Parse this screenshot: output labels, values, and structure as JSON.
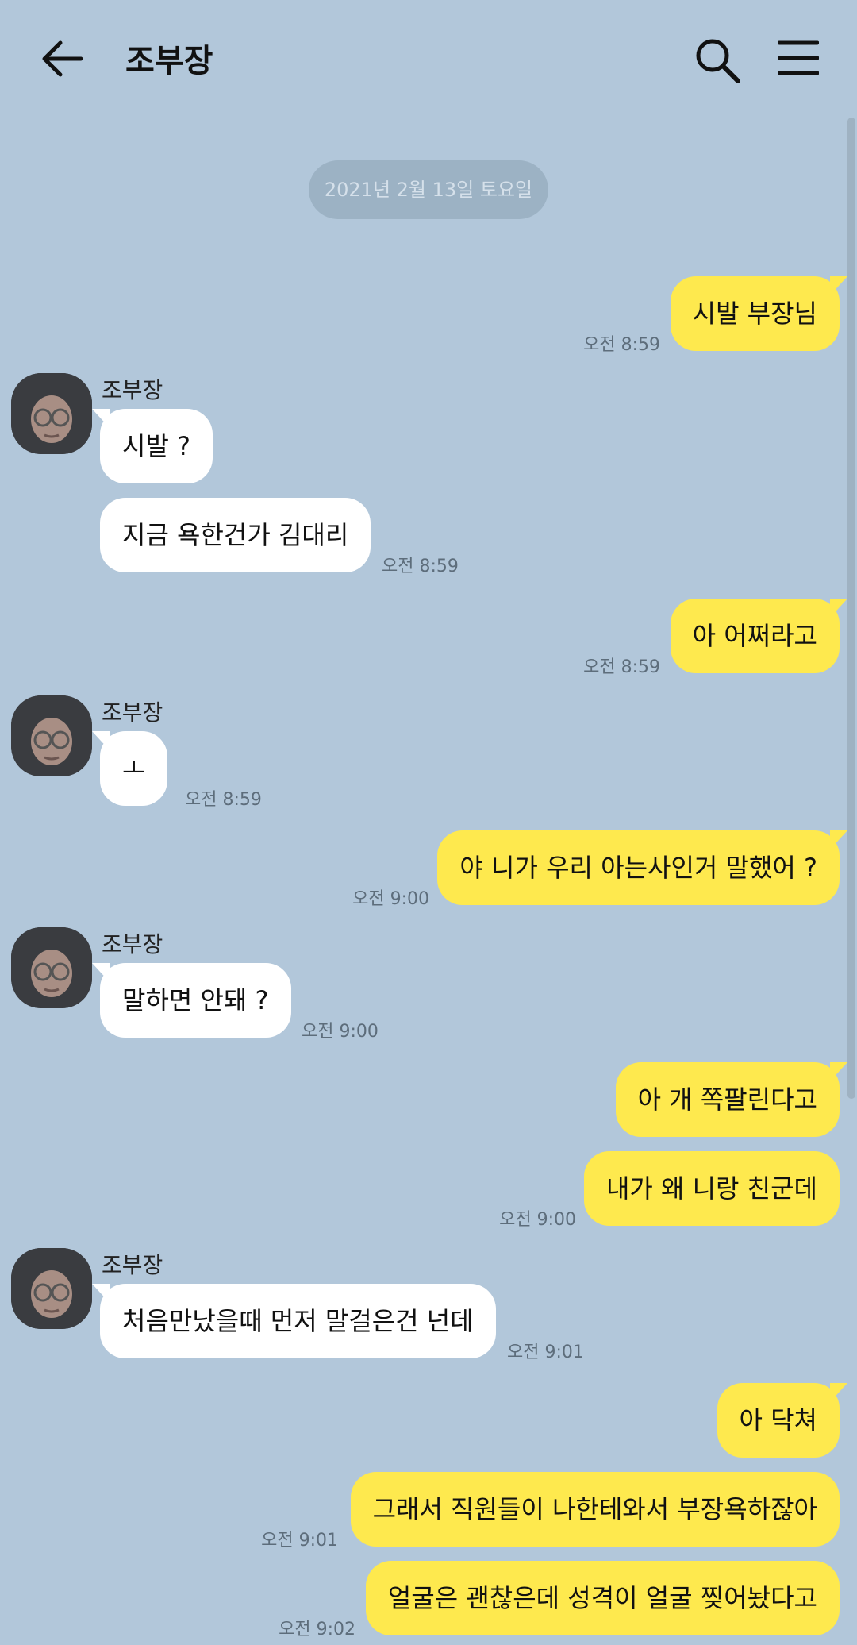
{
  "header": {
    "title": "조부장",
    "back_icon": "arrow-left-icon",
    "search_icon": "search-icon",
    "menu_icon": "hamburger-menu-icon"
  },
  "date_divider": "2021년 2월 13일 토요일",
  "sender_name": "조부장",
  "messages": [
    {
      "text": "시발 부장님",
      "time": "오전 8:59",
      "from": "me"
    },
    {
      "text": "시발 ?",
      "from": "other"
    },
    {
      "text": "지금 욕한건가 김대리",
      "time": "오전 8:59",
      "from": "other"
    },
    {
      "text": "아 어쩌라고",
      "time": "오전 8:59",
      "from": "me"
    },
    {
      "text": "ㅗ",
      "time": "오전 8:59",
      "from": "other"
    },
    {
      "text": "야 니가 우리 아는사인거 말했어 ?",
      "time": "오전 9:00",
      "from": "me"
    },
    {
      "text": "말하면 안돼 ?",
      "time": "오전 9:00",
      "from": "other"
    },
    {
      "text": "아 개 쪽팔린다고",
      "from": "me"
    },
    {
      "text": "내가 왜 니랑 친군데",
      "time": "오전 9:00",
      "from": "me"
    },
    {
      "text": "처음만났을때 먼저 말걸은건 넌데",
      "time": "오전 9:01",
      "from": "other"
    },
    {
      "text": "아 닥쳐",
      "from": "me"
    },
    {
      "text": "그래서 직원들이 나한테와서 부장욕하잖아",
      "time": "오전 9:01",
      "from": "me"
    },
    {
      "text": "얼굴은 괜찮은데 성격이 얼굴 찢어놨다고",
      "time": "오전 9:02",
      "from": "me"
    }
  ],
  "colors": {
    "background": "#b2c7da",
    "my_bubble": "#fee94e",
    "their_bubble": "#ffffff"
  }
}
